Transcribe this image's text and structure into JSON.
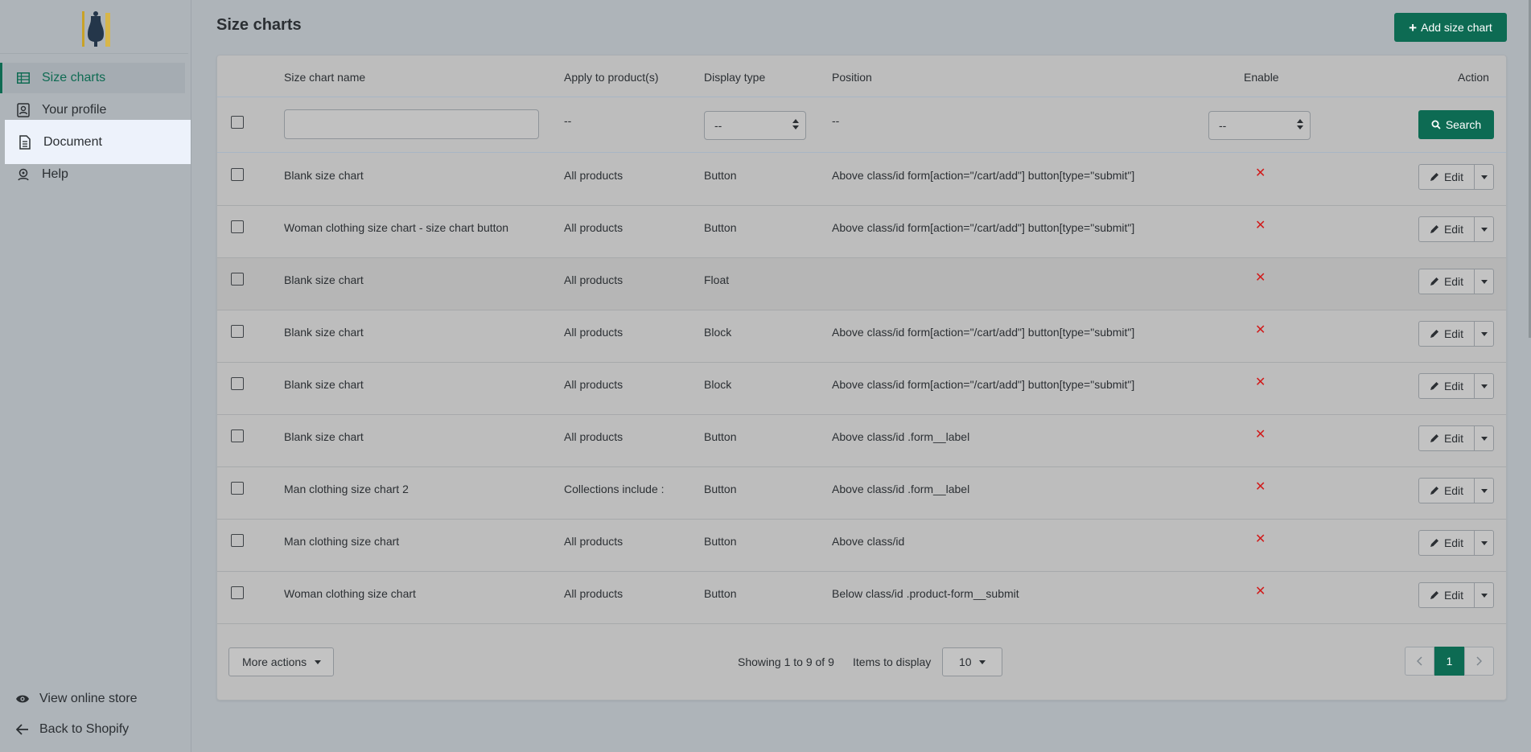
{
  "sidebar": {
    "items": [
      {
        "label": "Size charts",
        "icon": "table-icon"
      },
      {
        "label": "Your profile",
        "icon": "profile-icon"
      },
      {
        "label": "Document",
        "icon": "document-icon"
      },
      {
        "label": "Help",
        "icon": "help-icon"
      }
    ],
    "bottom": [
      {
        "label": "View online store",
        "icon": "eye-icon"
      },
      {
        "label": "Back to Shopify",
        "icon": "arrow-left-icon"
      }
    ]
  },
  "header": {
    "title": "Size charts",
    "add_button": "Add size chart"
  },
  "table": {
    "columns": [
      "Size chart name",
      "Apply to product(s)",
      "Display type",
      "Position",
      "Enable",
      "Action"
    ],
    "filters": {
      "name_value": "",
      "apply_placeholder": "--",
      "display_type_selected": "--",
      "position_placeholder": "--",
      "enable_selected": "--",
      "search_label": "Search"
    },
    "rows": [
      {
        "name": "Blank size chart",
        "apply": "All products",
        "display": "Button",
        "position": "Above class/id form[action=\"/cart/add\"] button[type=\"submit\"]",
        "enabled": false,
        "action": "Edit"
      },
      {
        "name": "Woman clothing size chart - size chart button",
        "apply": "All products",
        "display": "Button",
        "position": "Above class/id form[action=\"/cart/add\"] button[type=\"submit\"]",
        "enabled": false,
        "action": "Edit"
      },
      {
        "name": "Blank size chart",
        "apply": "All products",
        "display": "Float",
        "position": "",
        "enabled": false,
        "action": "Edit"
      },
      {
        "name": "Blank size chart",
        "apply": "All products",
        "display": "Block",
        "position": "Above class/id form[action=\"/cart/add\"] button[type=\"submit\"]",
        "enabled": false,
        "action": "Edit"
      },
      {
        "name": "Blank size chart",
        "apply": "All products",
        "display": "Block",
        "position": "Above class/id form[action=\"/cart/add\"] button[type=\"submit\"]",
        "enabled": false,
        "action": "Edit"
      },
      {
        "name": "Blank size chart",
        "apply": "All products",
        "display": "Button",
        "position": "Above class/id .form__label",
        "enabled": false,
        "action": "Edit"
      },
      {
        "name": "Man clothing size chart 2",
        "apply": "Collections include :",
        "display": "Button",
        "position": "Above class/id .form__label",
        "enabled": false,
        "action": "Edit"
      },
      {
        "name": "Man clothing size chart",
        "apply": "All products",
        "display": "Button",
        "position": "Above class/id",
        "enabled": false,
        "action": "Edit"
      },
      {
        "name": "Woman clothing size chart",
        "apply": "All products",
        "display": "Button",
        "position": "Below class/id .product-form__submit",
        "enabled": false,
        "action": "Edit"
      }
    ]
  },
  "footer": {
    "more_actions": "More actions",
    "showing": "Showing 1 to 9 of 9",
    "items_label": "Items to display",
    "items_value": "10",
    "current_page": "1"
  },
  "colors": {
    "accent": "#0d6b53",
    "disabled_x": "#d11b1b"
  }
}
